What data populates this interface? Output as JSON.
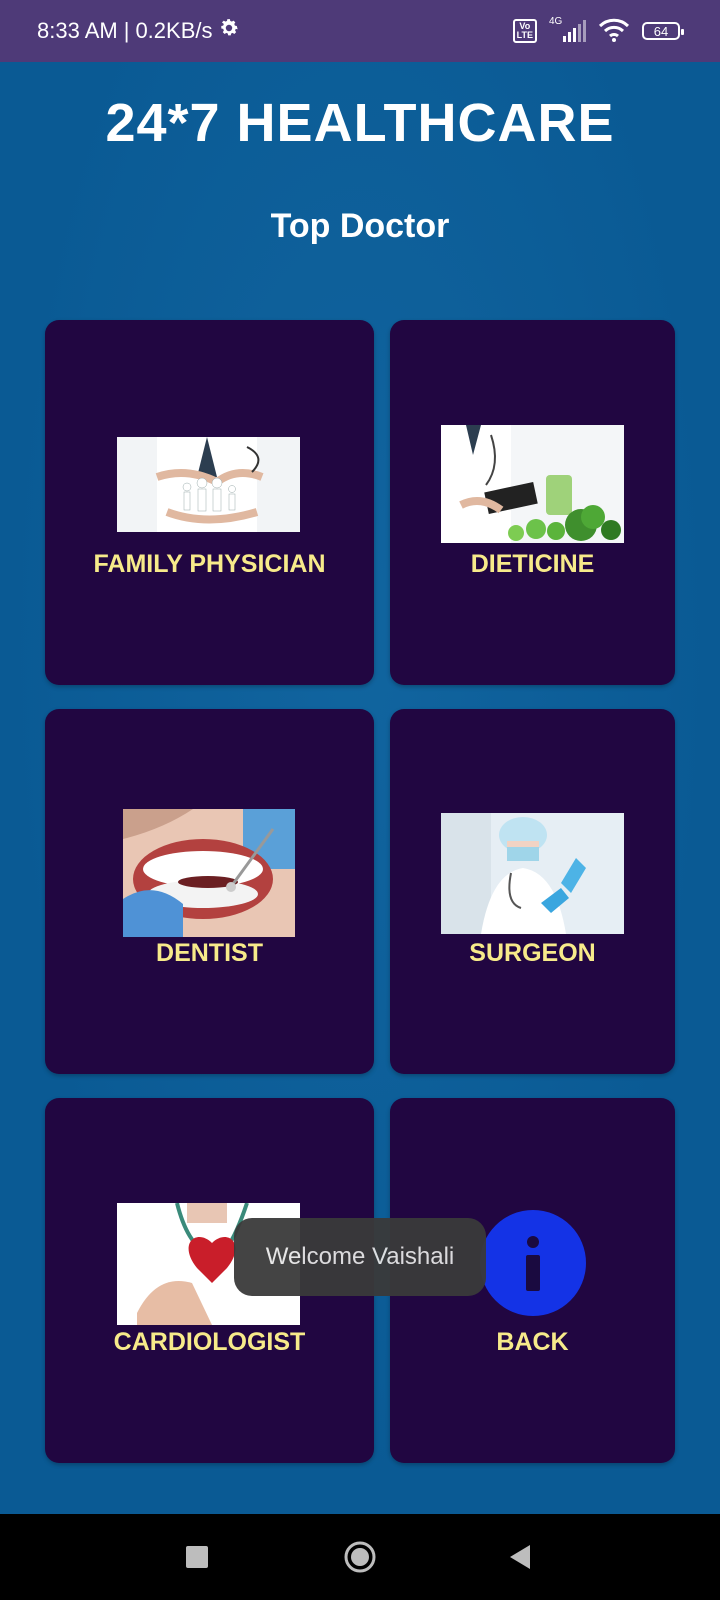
{
  "status_bar": {
    "time": "8:33 AM",
    "speed": "0.2KB/s",
    "volte_label": "Vo LTE",
    "network": "4G",
    "battery": "64",
    "icons": [
      "gear-icon",
      "volte-icon",
      "signal-icon",
      "wifi-icon",
      "battery-icon"
    ]
  },
  "header": {
    "title": "24*7 HEALTHCARE",
    "subtitle": "Top Doctor"
  },
  "cards": [
    {
      "label": "FAMILY PHYSICIAN",
      "image": "family-physician-image"
    },
    {
      "label": "DIETICINE",
      "image": "dietician-image"
    },
    {
      "label": "DENTIST",
      "image": "dentist-image"
    },
    {
      "label": "SURGEON",
      "image": "surgeon-image"
    },
    {
      "label": "CARDIOLOGIST",
      "image": "cardiologist-image"
    },
    {
      "label": "BACK",
      "image": "info-icon"
    }
  ],
  "toast": {
    "message": "Welcome Vaishali"
  },
  "nav_bar": {
    "icons": [
      "recents-square-icon",
      "home-circle-icon",
      "back-triangle-icon"
    ]
  },
  "colors": {
    "status_bar": "#4e3a78",
    "background": "#0a5a94",
    "card": "#210641",
    "card_label": "#f7ea8a",
    "info_blue": "#1433e6"
  }
}
